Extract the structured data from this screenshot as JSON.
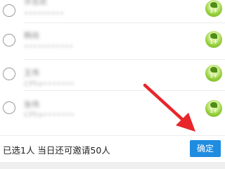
{
  "contacts": [
    {
      "name": "许志欢",
      "account": "•••••••••",
      "avatar_badge": "1+"
    },
    {
      "name": "韩尚",
      "account": "•••••••••••",
      "avatar_badge": "1+"
    },
    {
      "name": "王伟",
      "account": "CPhx•••••••",
      "avatar_badge": "1+"
    },
    {
      "name": "张伟",
      "account": "CPhx•••••••",
      "avatar_badge": "1+"
    }
  ],
  "bottom_bar": {
    "status_text": "已选1人 当日还可邀请50人",
    "confirm_label": "确定"
  },
  "colors": {
    "confirm_bg": "#1f8ce0",
    "arrow": "#e8262b",
    "avatar": "#96cf3c"
  }
}
